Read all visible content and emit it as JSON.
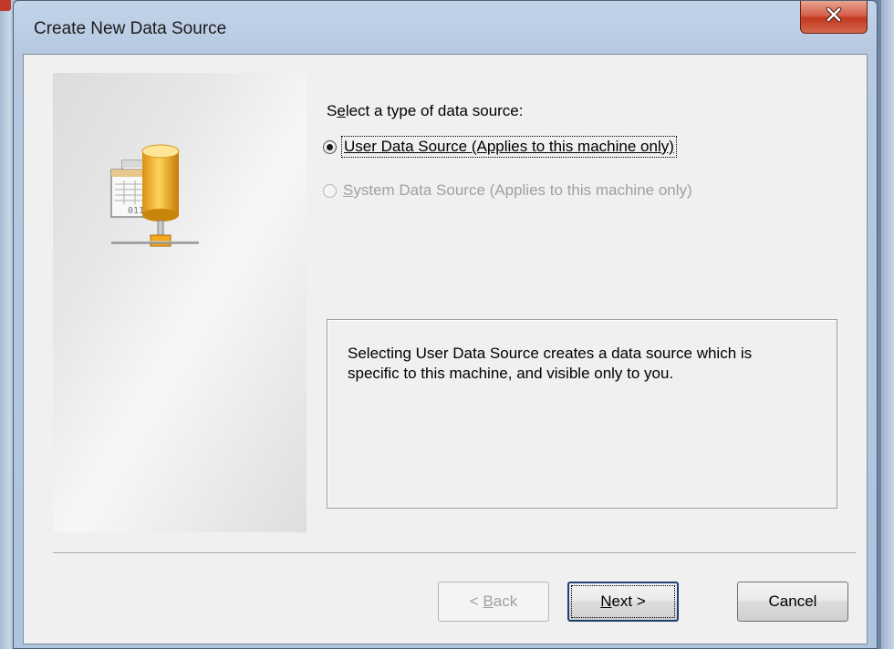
{
  "window": {
    "title": "Create New Data Source",
    "close_icon": "close-x-icon"
  },
  "panel": {
    "illustration_icon": "database-network-icon",
    "illustration_text": "011"
  },
  "form": {
    "prompt": "Select a type of data source:",
    "prompt_accel": "e",
    "options": [
      {
        "label": "User Data Source (Applies to this machine only)",
        "selected": true,
        "enabled": true
      },
      {
        "label_accel": "S",
        "label_rest": "ystem Data Source (Applies to this machine only)",
        "selected": false,
        "enabled": false
      }
    ]
  },
  "info": {
    "text": "Selecting User Data Source creates a data source which is specific to this machine, and visible only to you."
  },
  "buttons": {
    "back_prefix": "< ",
    "back_accel": "B",
    "back_rest": "ack",
    "next_accel": "N",
    "next_rest": "ext >",
    "cancel": "Cancel"
  },
  "colors": {
    "close_button": "#c2391f",
    "disabled_text": "#a0a0a0",
    "default_button_border": "#1d3f73"
  }
}
